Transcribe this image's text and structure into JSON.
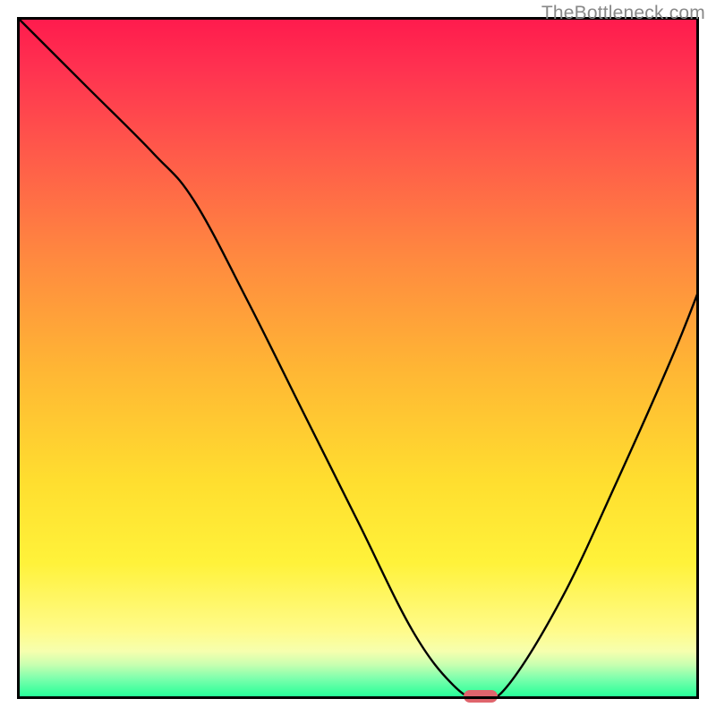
{
  "watermark": "TheBottleneck.com",
  "colors": {
    "gradient_top": "#ff1a4d",
    "gradient_bottom": "#1aff95",
    "curve": "#000000",
    "border": "#000000",
    "marker": "#e0656d"
  },
  "chart_data": {
    "type": "line",
    "title": "",
    "xlabel": "",
    "ylabel": "",
    "xlim": [
      0,
      100
    ],
    "ylim": [
      0,
      100
    ],
    "grid": false,
    "legend": false,
    "background_scale": "red (top / high bottleneck) → green (bottom / optimal)",
    "description": "Black curve showing bottleneck severity vs. configuration; dips to optimum near x≈68, red pill marks the optimum.",
    "series": [
      {
        "name": "bottleneck-curve",
        "x": [
          0,
          10,
          20,
          26,
          34,
          42,
          50,
          58,
          64,
          68,
          72,
          80,
          88,
          96,
          100
        ],
        "values": [
          100,
          90,
          80,
          73,
          58,
          42,
          26,
          10,
          2,
          0,
          2,
          15,
          32,
          50,
          60
        ]
      }
    ],
    "annotations": [
      {
        "name": "optimal-marker",
        "shape": "rounded-rect",
        "x": 68,
        "y": 0,
        "color": "#e0656d"
      }
    ]
  }
}
